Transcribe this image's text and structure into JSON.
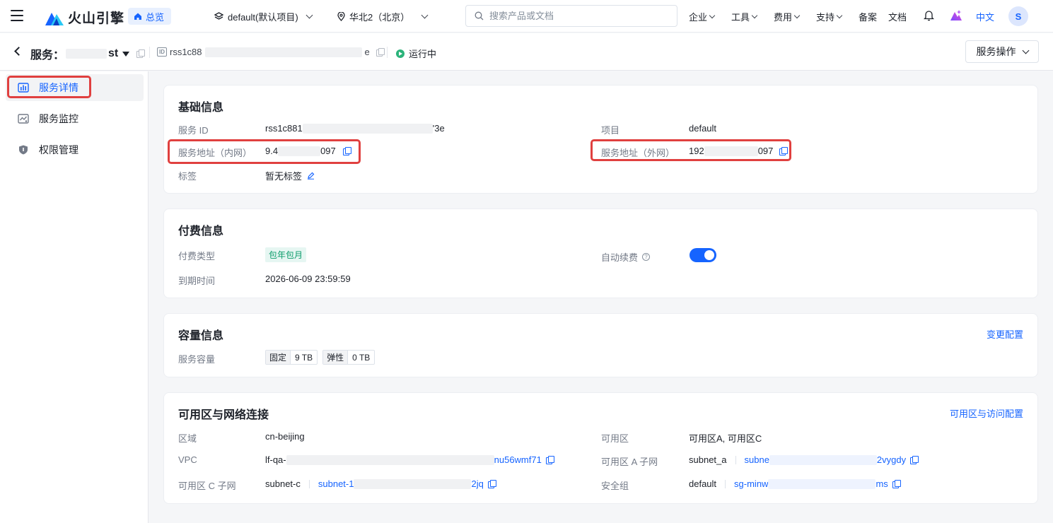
{
  "header": {
    "logo_text": "火山引擎",
    "home_label": "总览",
    "project_label": "default(默认项目)",
    "region_label": "华北2（北京）",
    "search_placeholder": "搜索产品或文档",
    "nav": [
      "企业",
      "工具",
      "费用",
      "支持",
      "备案",
      "文档"
    ],
    "lang": "中文",
    "avatar_initial": "S"
  },
  "subheader": {
    "title_prefix": "服务：",
    "title_suffix": "st",
    "id_badge": "ID",
    "id_prefix": "rss1c88",
    "id_suffix": "e",
    "status": "运行中",
    "service_ops": "服务操作"
  },
  "sidebar": {
    "items": [
      {
        "label": "服务详情",
        "active": true
      },
      {
        "label": "服务监控",
        "active": false
      },
      {
        "label": "权限管理",
        "active": false
      }
    ]
  },
  "basic": {
    "title": "基础信息",
    "service_id_label": "服务 ID",
    "service_id_prefix": "rss1c881",
    "service_id_suffix": "'3e",
    "inner_addr_label": "服务地址（内网）",
    "inner_addr_prefix": "9.4",
    "inner_addr_suffix": "097",
    "tag_label": "标签",
    "tag_value": "暂无标签",
    "project_label": "项目",
    "project_value": "default",
    "outer_addr_label": "服务地址（外网）",
    "outer_addr_prefix": "192",
    "outer_addr_suffix": "097"
  },
  "billing": {
    "title": "付费信息",
    "type_label": "付费类型",
    "type_value": "包年包月",
    "expire_label": "到期时间",
    "expire_value": "2026-06-09 23:59:59",
    "auto_renew_label": "自动续费",
    "help_glyph": "?",
    "auto_renew_on": true
  },
  "capacity": {
    "title": "容量信息",
    "change_link": "变更配置",
    "label": "服务容量",
    "fixed_key": "固定",
    "fixed_value": "9 TB",
    "elastic_key": "弹性",
    "elastic_value": "0 TB"
  },
  "network": {
    "title": "可用区与网络连接",
    "config_link": "可用区与访问配置",
    "region_label": "区域",
    "region_value": "cn-beijing",
    "vpc_label": "VPC",
    "vpc_prefix": "lf-qa-",
    "vpc_link_suffix": "nu56wmf71",
    "zone_c_subnet_label": "可用区 C 子网",
    "zone_c_subnet_name": "subnet-c",
    "zone_c_subnet_prefix": "subnet-1",
    "zone_c_subnet_suffix": "2jq",
    "zone_label": "可用区",
    "zone_value": "可用区A, 可用区C",
    "zone_a_subnet_label": "可用区 A 子网",
    "zone_a_subnet_name": "subnet_a",
    "zone_a_subnet_prefix": "subne",
    "zone_a_subnet_suffix": "2vygdy",
    "sg_label": "安全组",
    "sg_name": "default",
    "sg_prefix": "sg-minw",
    "sg_suffix": "ms"
  }
}
